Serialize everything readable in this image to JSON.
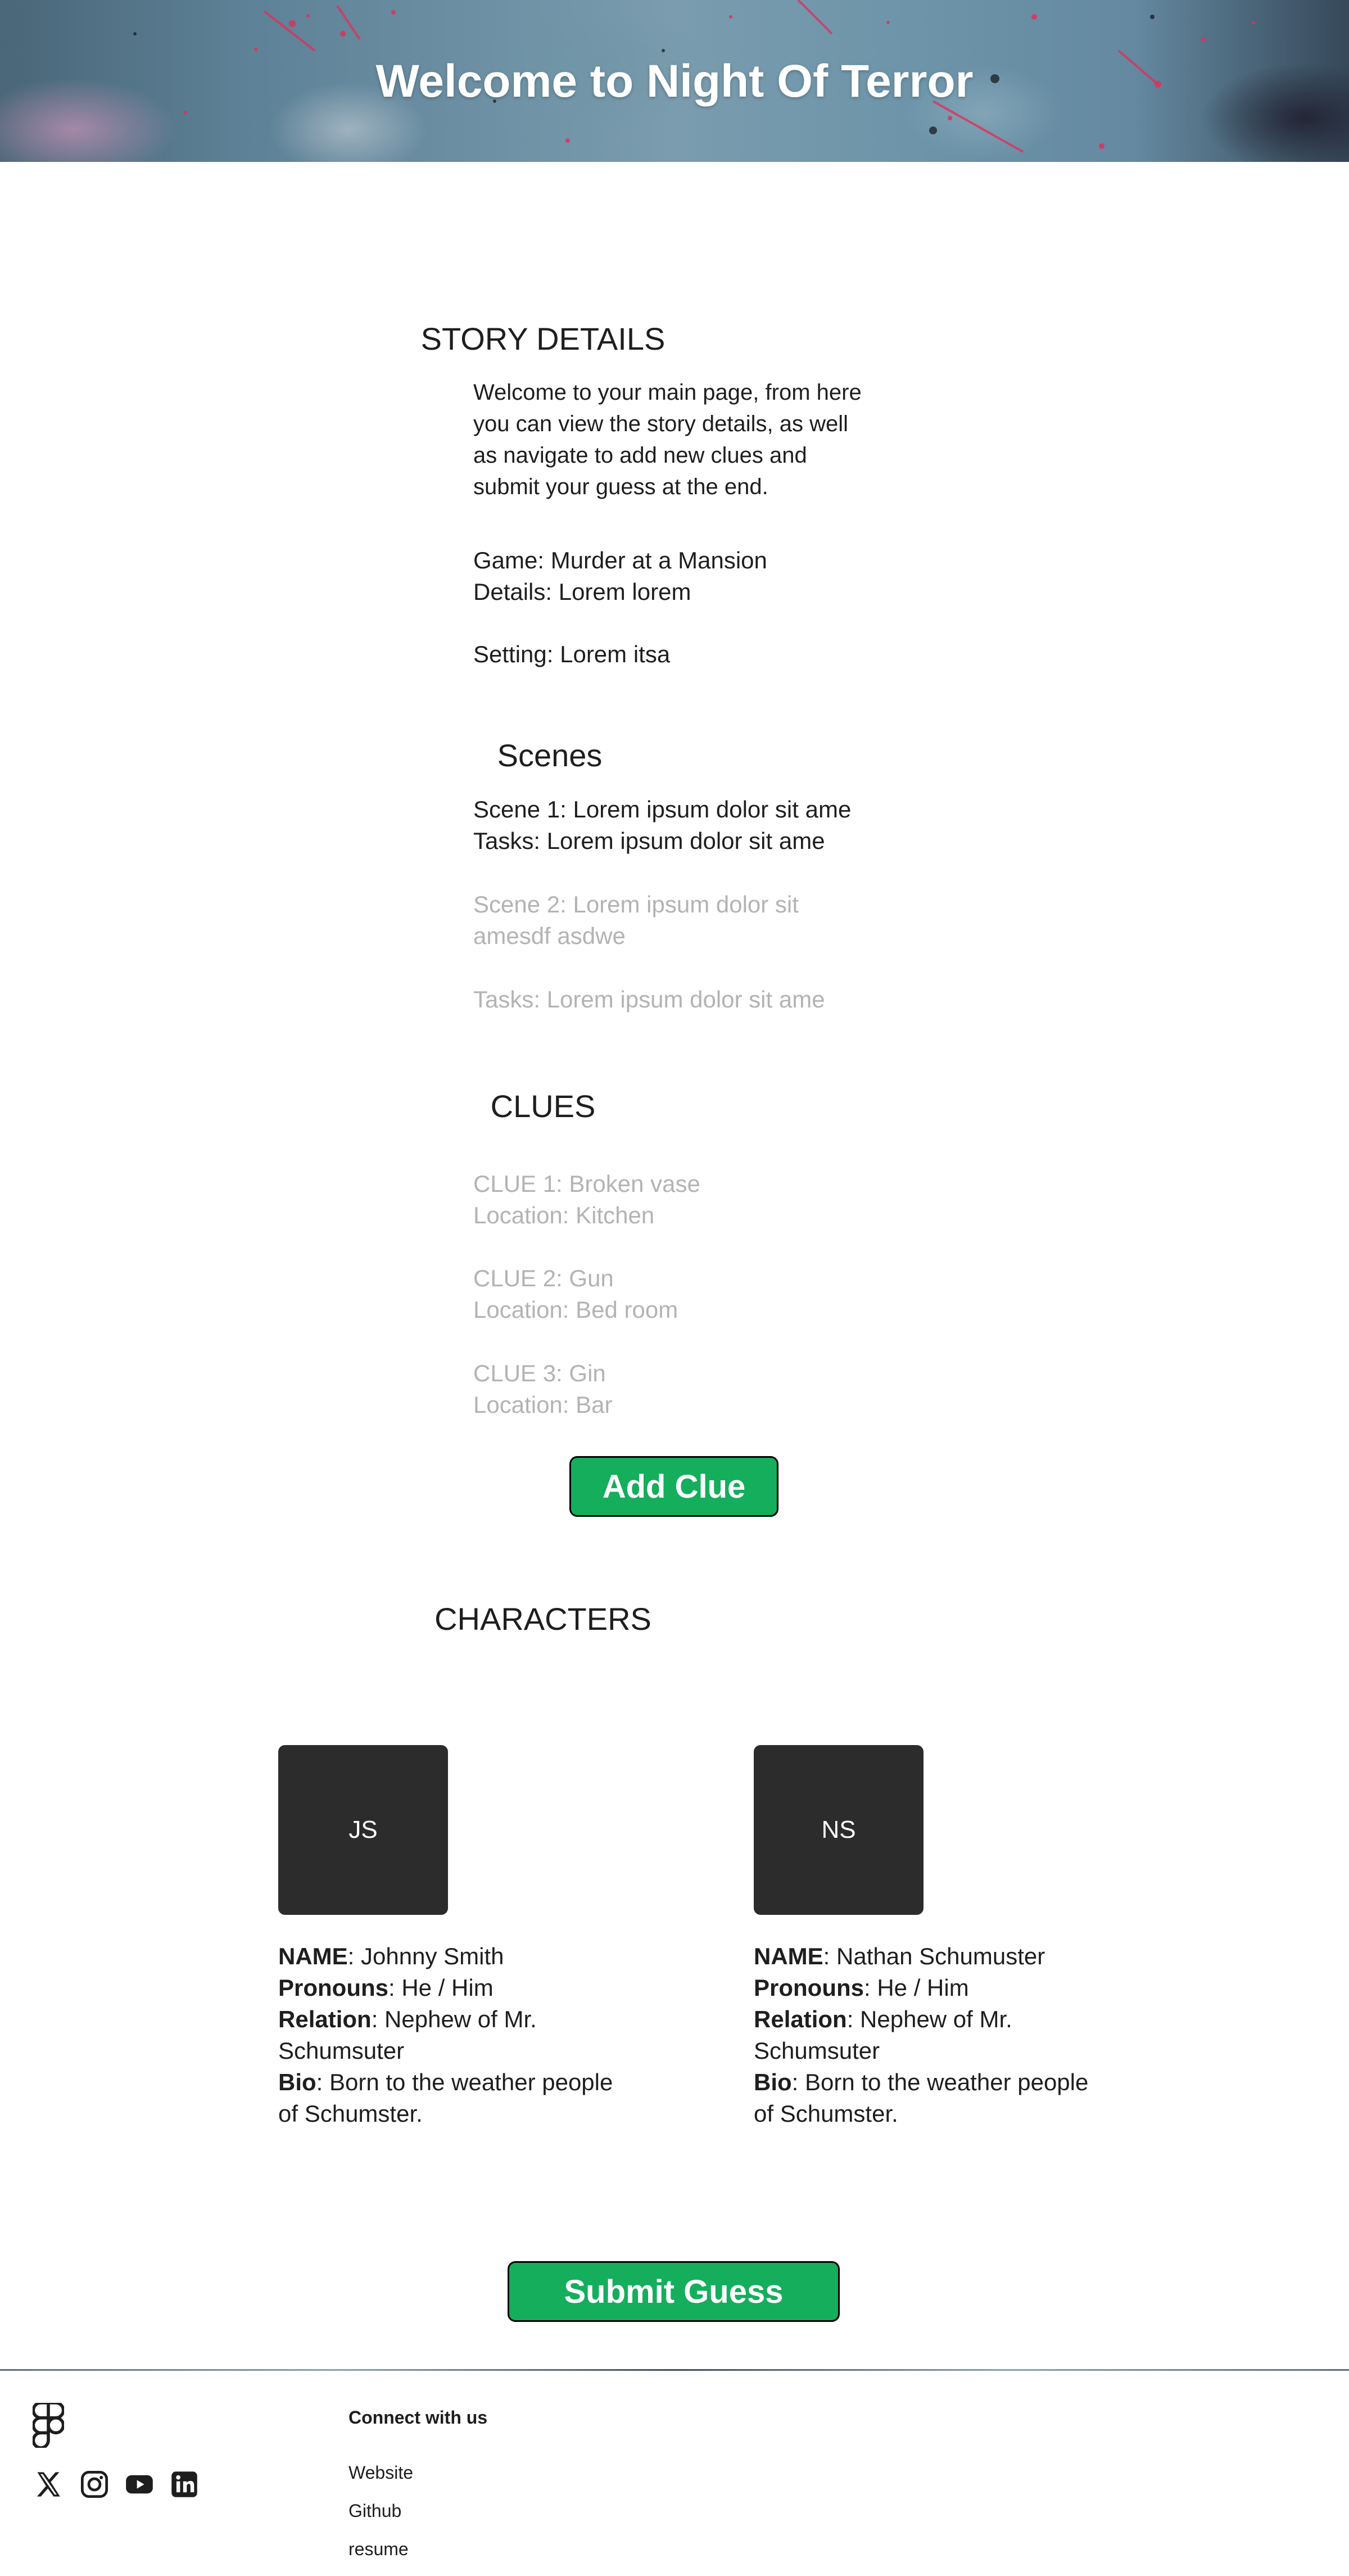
{
  "header": {
    "title": "Welcome to Night Of Terror"
  },
  "story": {
    "heading": "STORY DETAILS",
    "intro": "Welcome to your main page, from here you can view the story details, as well as navigate to add new clues and submit your guess at the end.",
    "game": "Game: Murder at a Mansion",
    "details": "Details: Lorem lorem",
    "setting": "Setting: Lorem itsa"
  },
  "scenes": {
    "heading": "Scenes",
    "items": [
      {
        "scene": "Scene 1: Lorem ipsum dolor sit ame",
        "tasks": "Tasks: Lorem ipsum dolor sit ame",
        "status": "active"
      },
      {
        "scene": "Scene 2: Lorem ipsum dolor sit amesdf asdwe",
        "tasks": "Tasks: Lorem ipsum dolor sit ame",
        "status": "locked"
      }
    ]
  },
  "clues": {
    "heading": "CLUES",
    "items": [
      {
        "name": "CLUE 1: Broken vase",
        "location": "Location: Kitchen"
      },
      {
        "name": "CLUE 2: Gun",
        "location": "Location: Bed room"
      },
      {
        "name": "CLUE 3: Gin",
        "location": "Location: Bar"
      }
    ],
    "add_button": "Add Clue"
  },
  "characters": {
    "heading": "CHARACTERS",
    "field_labels": {
      "name": "NAME",
      "pronouns": "Pronouns",
      "relation": "Relation",
      "bio": "Bio"
    },
    "items": [
      {
        "initials": "JS",
        "name": "Johnny Smith",
        "pronouns": "He / Him",
        "relation": "Nephew of Mr. Schumsuter",
        "bio": "Born to the weather people of Schumster."
      },
      {
        "initials": "NS",
        "name": "Nathan Schumuster",
        "pronouns": "He / Him",
        "relation": "Nephew of Mr. Schumsuter",
        "bio": "Born to the weather people of Schumster."
      }
    ]
  },
  "submit_button": "Submit Guess",
  "footer": {
    "heading": "Connect with us",
    "links": [
      "Website",
      "Github",
      "resume"
    ],
    "icons": [
      "figma-logo-icon",
      "x-twitter-icon",
      "instagram-icon",
      "youtube-icon",
      "linkedin-icon"
    ]
  },
  "colors": {
    "accent_green": "#14ae5c",
    "avatar_bg": "#2c2c2c",
    "muted_text": "#b3b3b3",
    "text": "#1e1e1e"
  }
}
